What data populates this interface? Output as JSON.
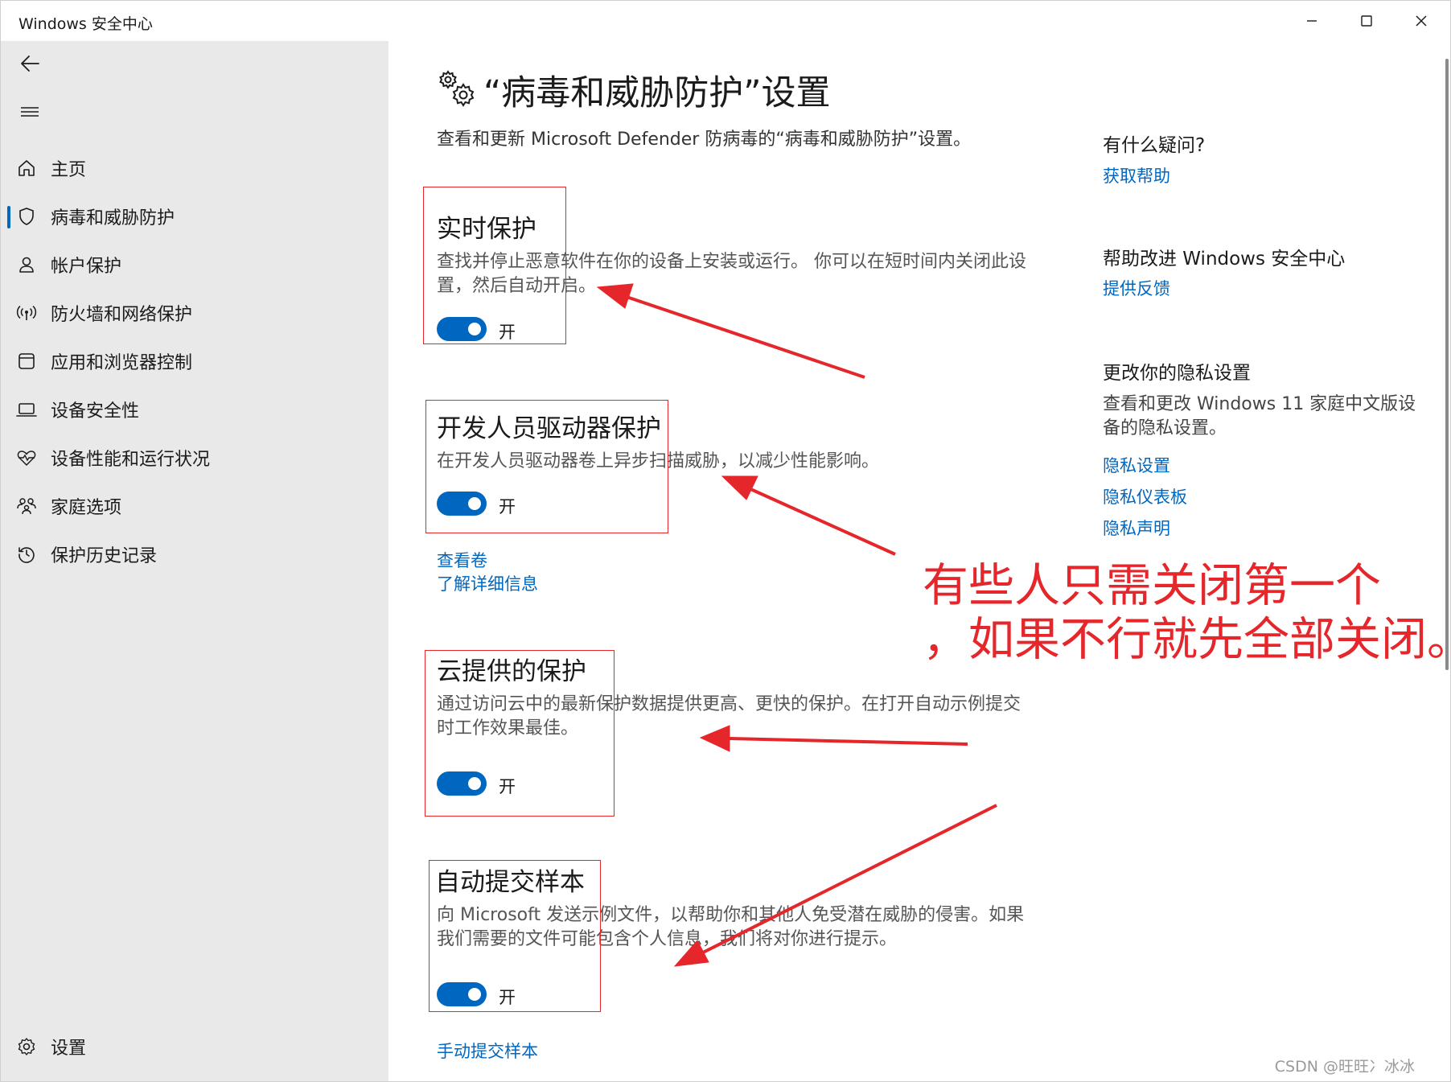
{
  "window": {
    "title": "Windows 安全中心"
  },
  "sidebar": {
    "items": [
      {
        "label": "主页",
        "icon": "home-icon"
      },
      {
        "label": "病毒和威胁防护",
        "icon": "shield-icon",
        "active": true
      },
      {
        "label": "帐户保护",
        "icon": "person-icon"
      },
      {
        "label": "防火墙和网络保护",
        "icon": "antenna-icon"
      },
      {
        "label": "应用和浏览器控制",
        "icon": "browser-window-icon"
      },
      {
        "label": "设备安全性",
        "icon": "laptop-icon"
      },
      {
        "label": "设备性能和运行状况",
        "icon": "heart-pulse-icon"
      },
      {
        "label": "家庭选项",
        "icon": "family-icon"
      },
      {
        "label": "保护历史记录",
        "icon": "history-icon"
      }
    ],
    "settings_label": "设置"
  },
  "main": {
    "title": "“病毒和威胁防护”设置",
    "description": "查看和更新 Microsoft Defender 防病毒的“病毒和威胁防护”设置。",
    "sections": [
      {
        "title": "实时保护",
        "description": "查找并停止恶意软件在你的设备上安装或运行。 你可以在短时间内关闭此设置，然后自动开启。",
        "toggle_label": "开",
        "toggle_on": true
      },
      {
        "title": "开发人员驱动器保护",
        "description": "在开发人员驱动器卷上异步扫描威胁，以减少性能影响。",
        "toggle_label": "开",
        "toggle_on": true,
        "links": [
          "查看卷",
          "了解详细信息"
        ]
      },
      {
        "title": "云提供的保护",
        "description": "通过访问云中的最新保护数据提供更高、更快的保护。在打开自动示例提交时工作效果最佳。",
        "toggle_label": "开",
        "toggle_on": true
      },
      {
        "title": "自动提交样本",
        "description": "向 Microsoft 发送示例文件，以帮助你和其他人免受潜在威胁的侵害。如果我们需要的文件可能包含个人信息，我们将对你进行提示。",
        "toggle_label": "开",
        "toggle_on": true,
        "links": [
          "手动提交样本"
        ]
      }
    ]
  },
  "right_column": {
    "help_title": "有什么疑问?",
    "help_link": "获取帮助",
    "improve_title": "帮助改进 Windows 安全中心",
    "improve_link": "提供反馈",
    "privacy_title": "更改你的隐私设置",
    "privacy_text": "查看和更改 Windows 11 家庭中文版设备的隐私设置。",
    "privacy_links": [
      "隐私设置",
      "隐私仪表板",
      "隐私声明"
    ]
  },
  "annotation": {
    "line1": "有些人只需关闭第一个",
    "line2": "，如果不行就先全部关闭。",
    "color": "#e5262b"
  },
  "watermark": "CSDN @旺旺冫冰冰",
  "colors": {
    "accent": "#0067c0",
    "sidebar_bg": "#e9e9e9",
    "annotation_red": "#e5262b"
  }
}
